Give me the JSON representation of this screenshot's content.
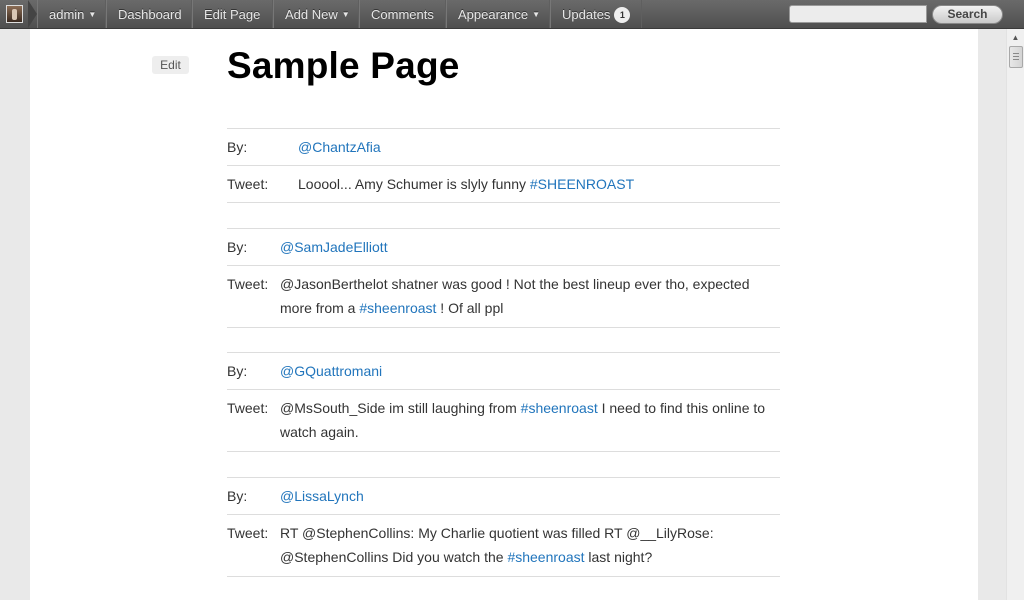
{
  "adminbar": {
    "user": "admin",
    "items": [
      "Dashboard",
      "Edit Page",
      "Add New",
      "Comments",
      "Appearance",
      "Updates"
    ],
    "updates_count": "1",
    "search_button": "Search",
    "search_placeholder": ""
  },
  "page": {
    "edit_label": "Edit",
    "title": "Sample Page",
    "labels": {
      "by": "By:",
      "tweet": "Tweet:"
    },
    "tweets": [
      {
        "author": "@ChantzAfia",
        "text_before": "Looool... Amy Schumer is slyly funny ",
        "hashtag": "#SHEENROAST",
        "text_after": ""
      },
      {
        "author": "@SamJadeElliott",
        "text_before": "@JasonBerthelot shatner was good ! Not the best lineup ever tho, expected more from a ",
        "hashtag": "#sheenroast",
        "text_after": " ! Of all ppl"
      },
      {
        "author": "@GQuattromani",
        "text_before": "@MsSouth_Side im still laughing from ",
        "hashtag": "#sheenroast",
        "text_after": " I need to find this online to watch again."
      },
      {
        "author": "@LissaLynch",
        "text_before": "RT @StephenCollins: My Charlie quotient was filled RT @__LilyRose: @StephenCollins Did you watch the ",
        "hashtag": "#sheenroast",
        "text_after": " last night?"
      }
    ]
  },
  "colors": {
    "link": "#2175bc",
    "adminbar": "#5a5a5a"
  }
}
